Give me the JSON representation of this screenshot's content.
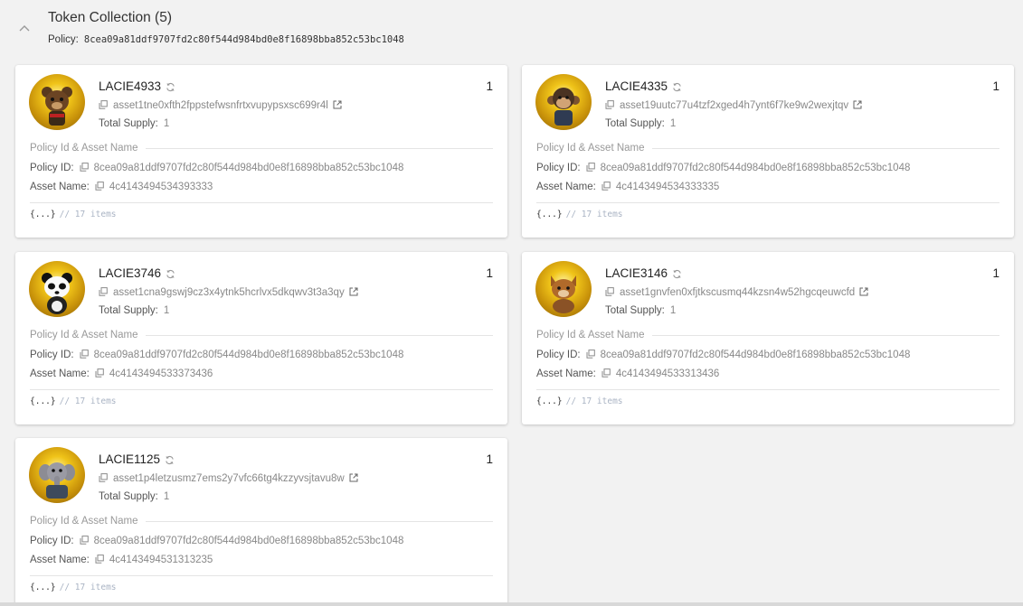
{
  "collection": {
    "title": "Token Collection (5)",
    "policy_label": "Policy:",
    "policy_value": "8cea09a81ddf9707fd2c80f544d984bd0e8f16898bba852c53bc1048"
  },
  "labels": {
    "total_supply": "Total Supply:",
    "section": "Policy Id & Asset Name",
    "policy_id": "Policy ID:",
    "asset_name": "Asset Name:",
    "json_braces": "{...}",
    "json_comment": "// 17 items"
  },
  "tokens": [
    {
      "name": "LACIE4933",
      "quantity": "1",
      "fingerprint": "asset1tne0xfth2fppstefwsnfrtxvupypsxsc699r4l",
      "supply": "1",
      "policy_id": "8cea09a81ddf9707fd2c80f544d984bd0e8f16898bba852c53bc1048",
      "asset_hex": "4c4143494534393333",
      "avatar_icon": "bear-character-icon"
    },
    {
      "name": "LACIE4335",
      "quantity": "1",
      "fingerprint": "asset19uutc77u4tzf2xged4h7ynt6f7ke9w2wexjtqv",
      "supply": "1",
      "policy_id": "8cea09a81ddf9707fd2c80f544d984bd0e8f16898bba852c53bc1048",
      "asset_hex": "4c4143494534333335",
      "avatar_icon": "monkey-character-icon"
    },
    {
      "name": "LACIE3746",
      "quantity": "1",
      "fingerprint": "asset1cna9gswj9cz3x4ytnk5hcrlvx5dkqwv3t3a3qy",
      "supply": "1",
      "policy_id": "8cea09a81ddf9707fd2c80f544d984bd0e8f16898bba852c53bc1048",
      "asset_hex": "4c4143494533373436",
      "avatar_icon": "panda-character-icon"
    },
    {
      "name": "LACIE3146",
      "quantity": "1",
      "fingerprint": "asset1gnvfen0xfjtkscusmq44kzsn4w52hgcqeuwcfd",
      "supply": "1",
      "policy_id": "8cea09a81ddf9707fd2c80f544d984bd0e8f16898bba852c53bc1048",
      "asset_hex": "4c4143494533313436",
      "avatar_icon": "fox-character-icon"
    },
    {
      "name": "LACIE1125",
      "quantity": "1",
      "fingerprint": "asset1p4letzusmz7ems2y7vfc66tg4kzzyvsjtavu8w",
      "supply": "1",
      "policy_id": "8cea09a81ddf9707fd2c80f544d984bd0e8f16898bba852c53bc1048",
      "asset_hex": "4c4143494531313235",
      "avatar_icon": "elephant-character-icon"
    }
  ]
}
